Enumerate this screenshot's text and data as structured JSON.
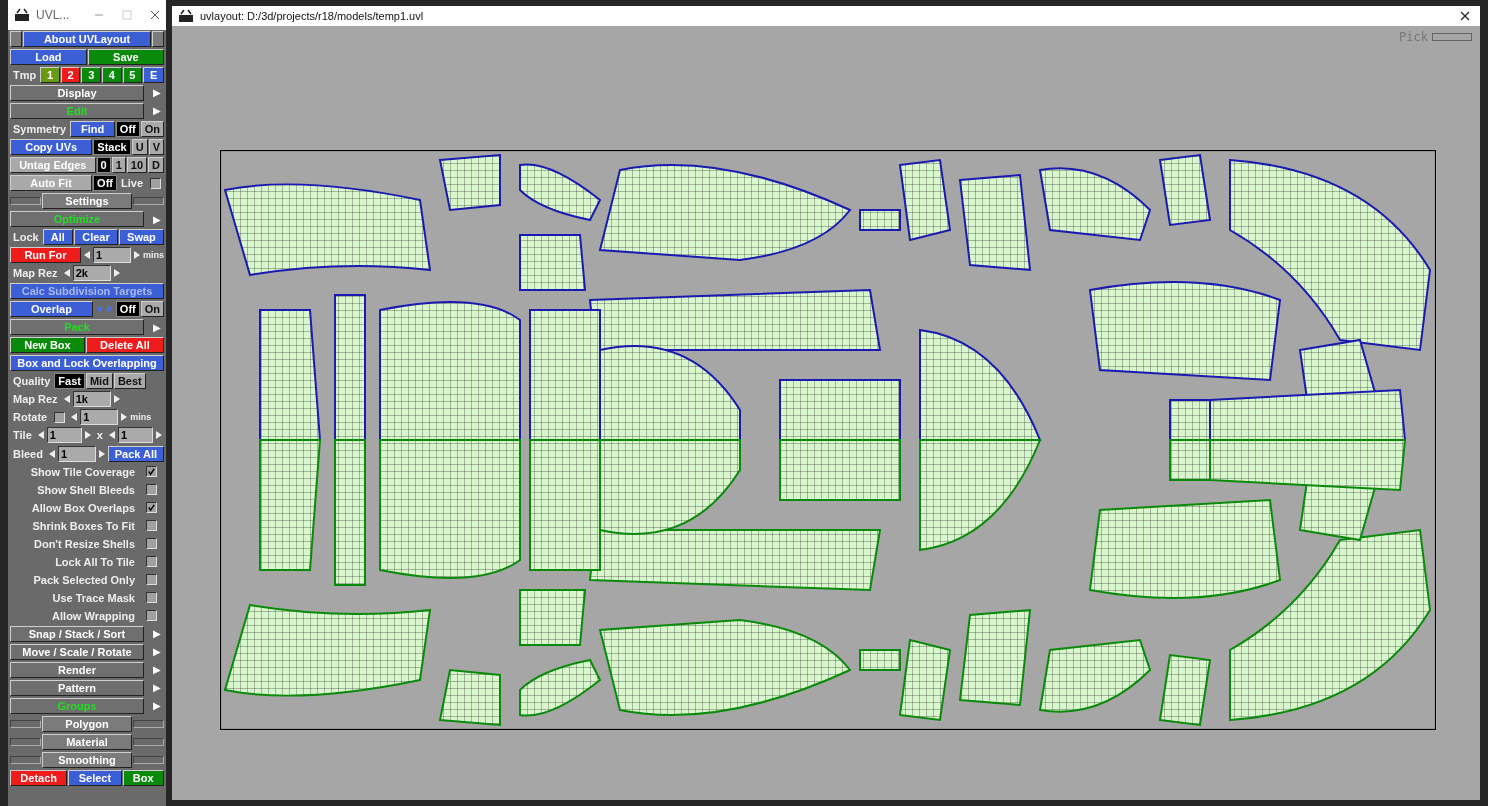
{
  "panel_window": {
    "title": "UVL..."
  },
  "panel_rows": [
    {
      "kind": "title",
      "label": "About UVLayout"
    },
    {
      "kind": "controls",
      "items": [
        {
          "kind": "button",
          "label": "Load",
          "color": "#3c5fd6"
        },
        {
          "kind": "button",
          "label": "Save",
          "color": "#0a8a0a"
        }
      ]
    },
    {
      "kind": "controls",
      "items": [
        {
          "kind": "label",
          "text": "Tmp"
        },
        {
          "kind": "button",
          "label": "1",
          "color": "#6a9a10"
        },
        {
          "kind": "button",
          "label": "2",
          "color": "#f01c1c"
        },
        {
          "kind": "button",
          "label": "3",
          "color": "#0a8a0a"
        },
        {
          "kind": "button",
          "label": "4",
          "color": "#0a8a0a"
        },
        {
          "kind": "button",
          "label": "5",
          "color": "#0a8a0a"
        },
        {
          "kind": "button",
          "label": "E",
          "color": "#3c5fd6"
        }
      ]
    },
    {
      "kind": "header",
      "label": "Display",
      "color": "#ffffff",
      "arrow": "▶"
    },
    {
      "kind": "header",
      "label": "Edit",
      "color": "#22dd22",
      "arrow": "▶"
    },
    {
      "kind": "controls",
      "items": [
        {
          "kind": "label",
          "text": "Symmetry"
        },
        {
          "kind": "button",
          "label": "Find",
          "color": "#3c5fd6"
        },
        {
          "kind": "toggle",
          "label": "Off",
          "selected": true
        },
        {
          "kind": "toggle",
          "label": "On",
          "selected": false
        }
      ]
    },
    {
      "kind": "controls",
      "items": [
        {
          "kind": "button",
          "label": "Copy UVs",
          "color": "#3c5fd6"
        },
        {
          "kind": "toggle",
          "label": "Stack",
          "selected": true
        },
        {
          "kind": "toggle",
          "label": "U",
          "selected": false
        },
        {
          "kind": "toggle",
          "label": "V",
          "selected": false
        }
      ]
    },
    {
      "kind": "controls",
      "items": [
        {
          "kind": "button",
          "label": "Untag Edges",
          "color": "#a9a9a9"
        },
        {
          "kind": "toggle",
          "label": "0",
          "selected": true
        },
        {
          "kind": "toggle",
          "label": "1",
          "selected": false
        },
        {
          "kind": "toggle",
          "label": "10",
          "selected": false
        },
        {
          "kind": "toggle",
          "label": "D",
          "selected": false
        }
      ]
    },
    {
      "kind": "controls",
      "items": [
        {
          "kind": "button",
          "label": "Auto Fit",
          "color": "#a9a9a9"
        },
        {
          "kind": "toggle",
          "label": "Off",
          "selected": true
        },
        {
          "kind": "label",
          "text": "Live"
        },
        {
          "kind": "checkbox",
          "checked": false
        }
      ]
    },
    {
      "kind": "slider",
      "label": "Settings"
    },
    {
      "kind": "header",
      "label": "Optimize",
      "color": "#22dd22",
      "arrow": "▶"
    },
    {
      "kind": "controls",
      "items": [
        {
          "kind": "label",
          "text": "Lock"
        },
        {
          "kind": "button",
          "label": "All",
          "color": "#3c5fd6"
        },
        {
          "kind": "button",
          "label": "Clear",
          "color": "#3c5fd6"
        },
        {
          "kind": "button",
          "label": "Swap",
          "color": "#3c5fd6"
        }
      ]
    },
    {
      "kind": "controls",
      "items": [
        {
          "kind": "button",
          "label": "Run For",
          "color": "#f01c1c"
        },
        {
          "kind": "spinner",
          "value": "1"
        },
        {
          "kind": "unit",
          "text": "mins"
        }
      ]
    },
    {
      "kind": "controls",
      "items": [
        {
          "kind": "label",
          "text": "Map Rez"
        },
        {
          "kind": "spinner",
          "value": "2k"
        }
      ]
    },
    {
      "kind": "controls",
      "items": [
        {
          "kind": "button",
          "label": "Calc Subdivision Targets",
          "color": "#3c5fd6",
          "disabled": true
        }
      ]
    },
    {
      "kind": "controls",
      "items": [
        {
          "kind": "button",
          "label": "Overlap",
          "color": "#3c5fd6"
        },
        {
          "kind": "nav"
        },
        {
          "kind": "toggle",
          "label": "Off",
          "selected": true
        },
        {
          "kind": "toggle",
          "label": "On",
          "selected": false
        }
      ]
    },
    {
      "kind": "header",
      "label": "Pack",
      "color": "#22dd22",
      "arrow": "▶"
    },
    {
      "kind": "controls",
      "items": [
        {
          "kind": "button",
          "label": "New Box",
          "color": "#0a8a0a"
        },
        {
          "kind": "button",
          "label": "Delete All",
          "color": "#f01c1c"
        }
      ]
    },
    {
      "kind": "controls",
      "items": [
        {
          "kind": "button",
          "label": "Box and Lock Overlapping",
          "color": "#3c5fd6"
        }
      ]
    },
    {
      "kind": "controls",
      "items": [
        {
          "kind": "label",
          "text": "Quality"
        },
        {
          "kind": "toggle",
          "label": "Fast",
          "selected": true
        },
        {
          "kind": "toggle",
          "label": "Mid",
          "selected": false
        },
        {
          "kind": "toggle",
          "label": "Best",
          "selected": false
        }
      ]
    },
    {
      "kind": "controls",
      "items": [
        {
          "kind": "label",
          "text": "Map Rez"
        },
        {
          "kind": "spinner",
          "value": "1k"
        }
      ]
    },
    {
      "kind": "controls",
      "items": [
        {
          "kind": "label",
          "text": "Rotate"
        },
        {
          "kind": "checkbox",
          "checked": false
        },
        {
          "kind": "spinner",
          "value": "1"
        },
        {
          "kind": "unit",
          "text": "mins"
        }
      ]
    },
    {
      "kind": "controls",
      "items": [
        {
          "kind": "label",
          "text": "Tile"
        },
        {
          "kind": "spinner",
          "value": "1"
        },
        {
          "kind": "label",
          "text": "x"
        },
        {
          "kind": "spinner",
          "value": "1"
        }
      ]
    },
    {
      "kind": "controls",
      "items": [
        {
          "kind": "label",
          "text": "Bleed"
        },
        {
          "kind": "spinner",
          "value": "1"
        },
        {
          "kind": "button",
          "label": "Pack All",
          "color": "#3c5fd6"
        }
      ]
    },
    {
      "kind": "check",
      "label": "Show Tile Coverage",
      "checked": true
    },
    {
      "kind": "check",
      "label": "Show Shell Bleeds",
      "checked": false
    },
    {
      "kind": "check",
      "label": "Allow Box Overlaps",
      "checked": true
    },
    {
      "kind": "check",
      "label": "Shrink Boxes To Fit",
      "checked": false
    },
    {
      "kind": "check",
      "label": "Don't Resize Shells",
      "checked": false
    },
    {
      "kind": "check",
      "label": "Lock All To Tile",
      "checked": false
    },
    {
      "kind": "check",
      "label": "Pack Selected Only",
      "checked": false
    },
    {
      "kind": "check",
      "label": "Use Trace Mask",
      "checked": false
    },
    {
      "kind": "check",
      "label": "Allow Wrapping",
      "checked": false
    },
    {
      "kind": "header",
      "label": "Snap / Stack / Sort",
      "color": "#ffffff",
      "arrow": "▶"
    },
    {
      "kind": "header",
      "label": "Move / Scale / Rotate",
      "color": "#ffffff",
      "arrow": "▶"
    },
    {
      "kind": "header",
      "label": "Render",
      "color": "#ffffff",
      "arrow": "▶"
    },
    {
      "kind": "header",
      "label": "Pattern",
      "color": "#ffffff",
      "arrow": "▶"
    },
    {
      "kind": "header",
      "label": "Groups",
      "color": "#22dd22",
      "arrow": "▶"
    },
    {
      "kind": "slider",
      "label": "Polygon"
    },
    {
      "kind": "slider",
      "label": "Material"
    },
    {
      "kind": "slider",
      "label": "Smoothing"
    },
    {
      "kind": "controls",
      "items": [
        {
          "kind": "button",
          "label": "Detach",
          "color": "#f01c1c"
        },
        {
          "kind": "button",
          "label": "Select",
          "color": "#3c5fd6"
        },
        {
          "kind": "button",
          "label": "Box",
          "color": "#0a8a0a"
        }
      ]
    }
  ],
  "main_window": {
    "title": "uvlayout: D:/3d/projects/r18/models/temp1.uvl",
    "pick_label": "Pick"
  }
}
